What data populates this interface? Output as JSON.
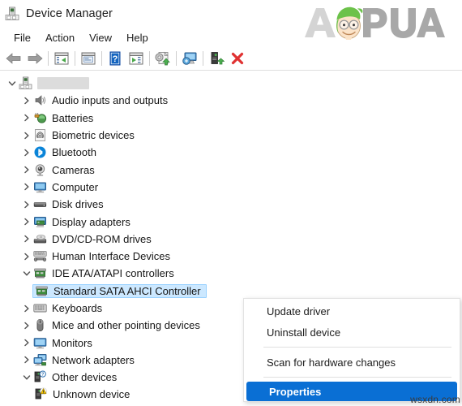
{
  "window": {
    "title": "Device Manager",
    "icon": "device-manager-icon"
  },
  "menubar": {
    "items": [
      {
        "label": "File",
        "name": "menu-file"
      },
      {
        "label": "Action",
        "name": "menu-action"
      },
      {
        "label": "View",
        "name": "menu-view"
      },
      {
        "label": "Help",
        "name": "menu-help"
      }
    ]
  },
  "toolbar": {
    "buttons": [
      {
        "name": "back-icon",
        "title": "Back"
      },
      {
        "name": "forward-icon",
        "title": "Forward"
      },
      {
        "name": "separator-1",
        "title": ""
      },
      {
        "name": "show-hide-console-tree-icon",
        "title": "Show/Hide Console Tree"
      },
      {
        "name": "separator-2",
        "title": ""
      },
      {
        "name": "properties-icon",
        "title": "Properties"
      },
      {
        "name": "separator-3",
        "title": ""
      },
      {
        "name": "help-icon",
        "title": "Help"
      },
      {
        "name": "show-hide-action-pane-icon",
        "title": "Show/Hide Action Pane"
      },
      {
        "name": "separator-4",
        "title": ""
      },
      {
        "name": "update-driver-icon",
        "title": "Update driver"
      },
      {
        "name": "separator-5",
        "title": ""
      },
      {
        "name": "scan-for-hardware-changes-icon",
        "title": "Scan for hardware changes"
      },
      {
        "name": "separator-6",
        "title": ""
      },
      {
        "name": "enable-device-icon",
        "title": "Enable device"
      },
      {
        "name": "uninstall-device-icon",
        "title": "Uninstall device"
      }
    ]
  },
  "tree": {
    "root": {
      "label": "",
      "redacted": true,
      "icon": "computer-root-icon",
      "expanded": true
    },
    "nodes": [
      {
        "label": "Audio inputs and outputs",
        "icon": "speaker-icon",
        "expanded": false,
        "level": 2,
        "expandable": true
      },
      {
        "label": "Batteries",
        "icon": "battery-icon",
        "expanded": false,
        "level": 2,
        "expandable": true
      },
      {
        "label": "Biometric devices",
        "icon": "fingerprint-icon",
        "expanded": false,
        "level": 2,
        "expandable": true
      },
      {
        "label": "Bluetooth",
        "icon": "bluetooth-icon",
        "expanded": false,
        "level": 2,
        "expandable": true
      },
      {
        "label": "Cameras",
        "icon": "camera-icon",
        "expanded": false,
        "level": 2,
        "expandable": true
      },
      {
        "label": "Computer",
        "icon": "computer-icon",
        "expanded": false,
        "level": 2,
        "expandable": true
      },
      {
        "label": "Disk drives",
        "icon": "disk-drive-icon",
        "expanded": false,
        "level": 2,
        "expandable": true
      },
      {
        "label": "Display adapters",
        "icon": "display-adapter-icon",
        "expanded": false,
        "level": 2,
        "expandable": true
      },
      {
        "label": "DVD/CD-ROM drives",
        "icon": "dvd-drive-icon",
        "expanded": false,
        "level": 2,
        "expandable": true
      },
      {
        "label": "Human Interface Devices",
        "icon": "hid-icon",
        "expanded": false,
        "level": 2,
        "expandable": true
      },
      {
        "label": "IDE ATA/ATAPI controllers",
        "icon": "ide-controller-icon",
        "expanded": true,
        "level": 2,
        "expandable": true
      },
      {
        "label": "Standard SATA AHCI Controller",
        "icon": "ide-controller-icon",
        "expanded": false,
        "level": 3,
        "expandable": false,
        "selected": true
      },
      {
        "label": "Keyboards",
        "icon": "keyboard-icon",
        "expanded": false,
        "level": 2,
        "expandable": true
      },
      {
        "label": "Mice and other pointing devices",
        "icon": "mouse-icon",
        "expanded": false,
        "level": 2,
        "expandable": true
      },
      {
        "label": "Monitors",
        "icon": "monitor-icon",
        "expanded": false,
        "level": 2,
        "expandable": true
      },
      {
        "label": "Network adapters",
        "icon": "network-adapter-icon",
        "expanded": false,
        "level": 2,
        "expandable": true
      },
      {
        "label": "Other devices",
        "icon": "other-devices-icon",
        "expanded": true,
        "level": 2,
        "expandable": true
      },
      {
        "label": "Unknown device",
        "icon": "unknown-device-warning-icon",
        "expanded": false,
        "level": 3,
        "expandable": false
      }
    ]
  },
  "context_menu": {
    "items": [
      {
        "label": "Update driver",
        "type": "item",
        "name": "ctx-update-driver"
      },
      {
        "label": "Uninstall device",
        "type": "item",
        "name": "ctx-uninstall-device"
      },
      {
        "label": "",
        "type": "separator",
        "name": "ctx-separator-1"
      },
      {
        "label": "Scan for hardware changes",
        "type": "item",
        "name": "ctx-scan-for-hardware-changes"
      },
      {
        "label": "",
        "type": "separator",
        "name": "ctx-separator-2"
      },
      {
        "label": "Properties",
        "type": "item",
        "name": "ctx-properties",
        "highlighted": true
      }
    ]
  },
  "watermarks": {
    "brand": "APPUALS",
    "site": "wsxdn.com"
  },
  "colors": {
    "selection_fill": "#cce8ff",
    "selection_border": "#99d1ff",
    "menu_highlight": "#0a6fd4",
    "bluetooth_blue": "#0a84d8",
    "warning_yellow": "#f2c300",
    "close_red": "#e03131",
    "logo_gray": "#d4d4d4",
    "beret_green": "#6cc24a"
  }
}
